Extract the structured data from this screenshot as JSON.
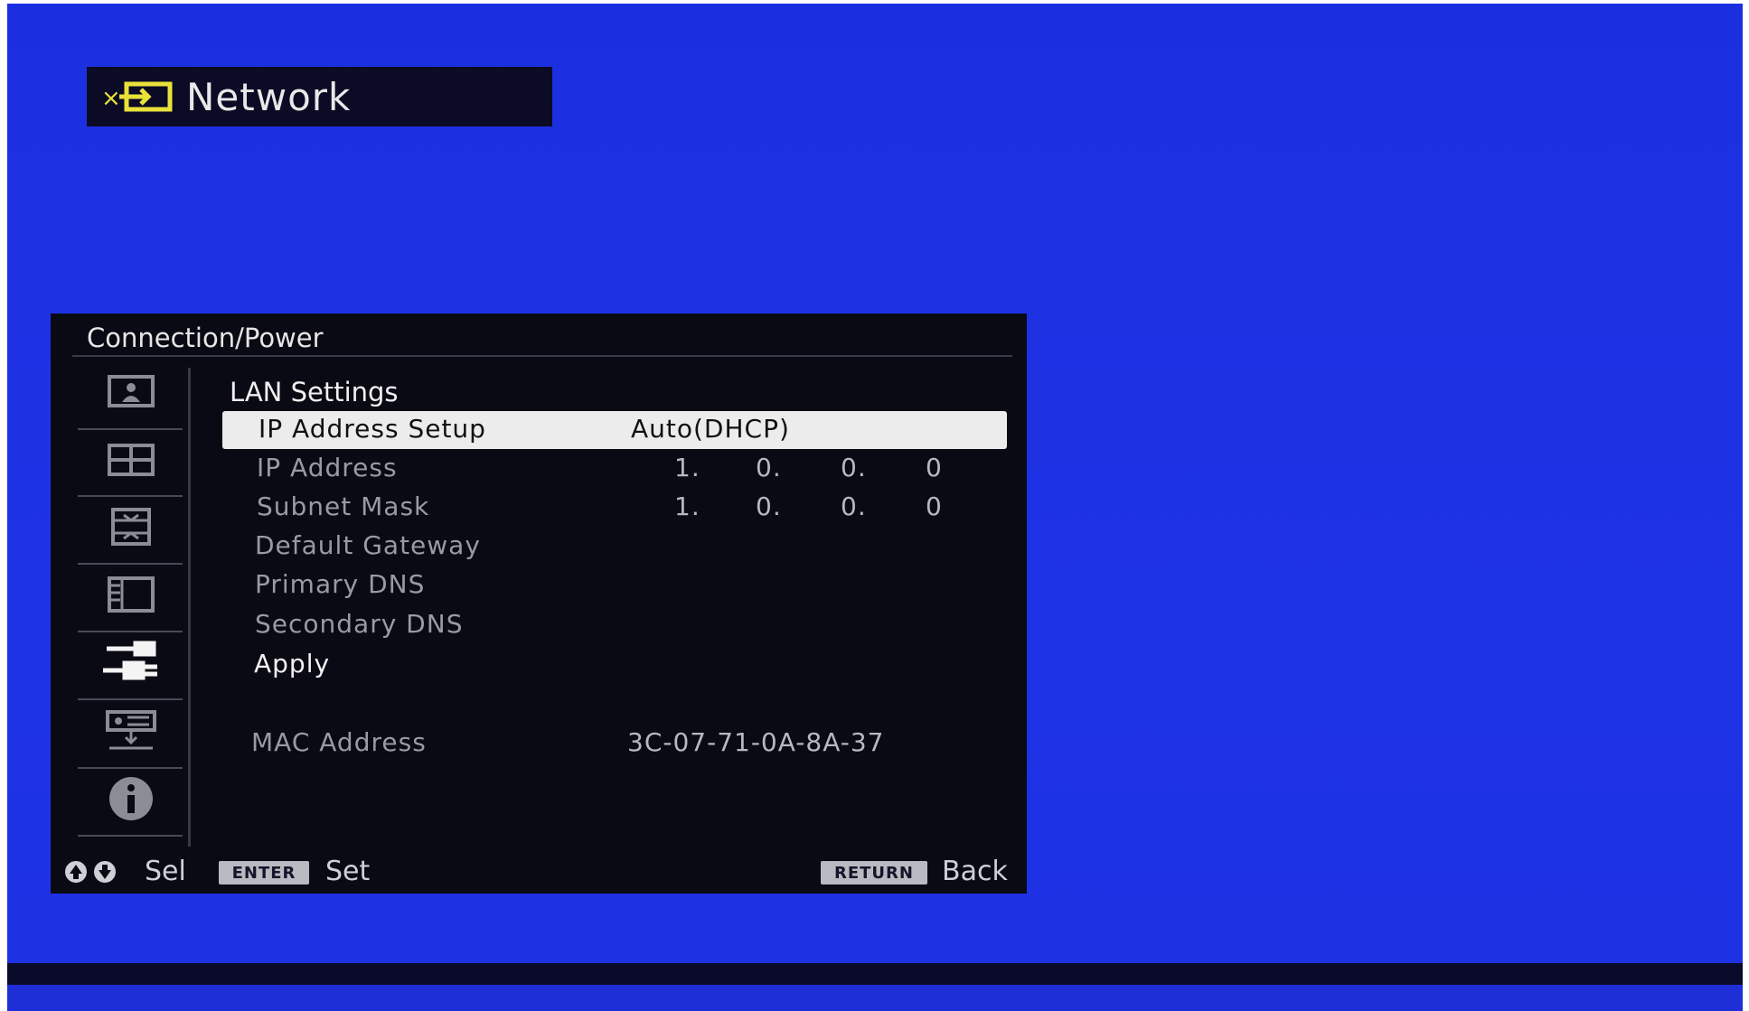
{
  "title": {
    "text": "Network",
    "icon": "network-input-icon"
  },
  "panel": {
    "header": "Connection/Power",
    "section_title": "LAN Settings",
    "sidebar": [
      {
        "icon": "picture-icon",
        "selected": false
      },
      {
        "icon": "screen-icon",
        "selected": false
      },
      {
        "icon": "setup-icon",
        "selected": false
      },
      {
        "icon": "display-function-icon",
        "selected": false
      },
      {
        "icon": "connection-power-icon",
        "selected": true
      },
      {
        "icon": "installation-icon",
        "selected": false
      },
      {
        "icon": "information-icon",
        "selected": false
      }
    ],
    "rows": {
      "ip_setup": {
        "label": "IP Address Setup",
        "value": "Auto(DHCP)"
      },
      "ip_address": {
        "label": "IP Address",
        "octets": [
          "1.",
          "0.",
          "0.",
          "0"
        ]
      },
      "subnet_mask": {
        "label": "Subnet Mask",
        "octets": [
          "1.",
          "0.",
          "0.",
          "0"
        ]
      },
      "default_gateway": {
        "label": "Default Gateway"
      },
      "primary_dns": {
        "label": "Primary DNS"
      },
      "secondary_dns": {
        "label": "Secondary DNS"
      },
      "apply": {
        "label": "Apply"
      },
      "mac": {
        "label": "MAC Address",
        "value": "3C-07-71-0A-8A-37"
      }
    },
    "footer": {
      "sel_label": "Sel",
      "enter_key": "ENTER",
      "set_label": "Set",
      "return_key": "RETURN",
      "back_label": "Back"
    }
  },
  "colors": {
    "background": "#1f33e6",
    "panel": "#0a0a14",
    "highlight": "#ececec",
    "title_icon": "#e8e23a"
  }
}
